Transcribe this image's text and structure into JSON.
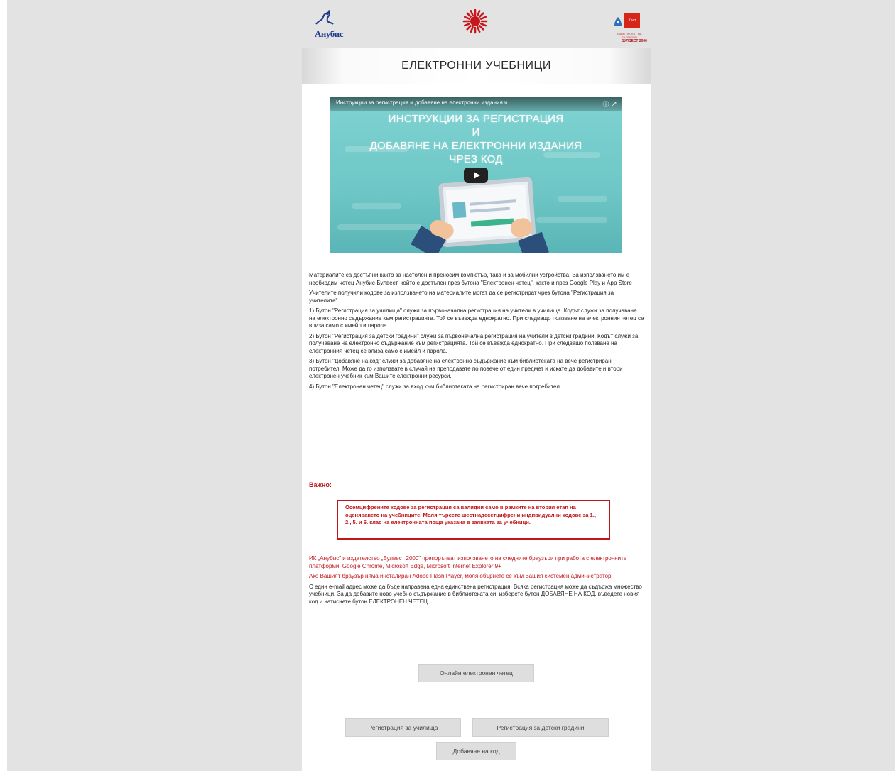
{
  "logos": {
    "left_text": "Анубис",
    "middle_text": "БУЛВЕСТ 2000",
    "right_text": "Клет",
    "right_subtext": "ЕДИН ПРОЕКТ НА БЪЛГАРИЯ"
  },
  "page_title": "ЕЛЕКТРОННИ УЧЕБНИЦИ",
  "video": {
    "title": "Инструкции за регистрация и добавяне на електронни издания ч...",
    "headline_1": "ИНСТРУКЦИИ ЗА РЕГИСТРАЦИЯ",
    "headline_2": "И",
    "headline_3": "ДОБАВЯНЕ НА ЕЛЕКТРОННИ ИЗДАНИЯ",
    "headline_4": "ЧРЕЗ КОД"
  },
  "paragraphs": {
    "p1": "Материалите са достъпни както за настолен и преносим компютър, така и за мобилни устройства. За използването им е необходим четец Анубис-Булвест, който е достъпен през бутона \"Електронен четец\", както и през Google Play и App Store",
    "p2": "Учителите получили кодове за използването на материалите могат да се регистрират чрез бутона \"Регистрация за учителите\".",
    "p3": "1) Бутон \"Регистрация за училища\" служи за първоначална регистрация на учители в училища. Кодът служи за получаване на електронно съдържание към регистрацията. Той се въвежда еднократно. При следващо ползване на електронния четец се влиза само с имейл и парола.",
    "p4": "2) Бутон \"Регистрация за детски градини\" служи за първоначална регистрация на учители в детски градини. Кодът служи за получаване на електронно съдържание към регистрацията. Той се въвежда еднократно. При следващо ползване на електронния четец се влиза само с имейл и парола.",
    "p5": "3) Бутон \"Добавяне на код\" служи за добавяне на електронно съдържание към библиотеката на вече регистриран потребител. Може да го използвате в случай на преподавате по повече от един предмет и искате да добавите и втори електронен учебник към Вашите електронни ресурси.",
    "p6": "4) Бутон \"Електронен четец\" служи за вход към библиотеката на регистриран вече потребител."
  },
  "warning": {
    "label": "Важно:",
    "box_text": "Осемцифрените кодове за регистрация са валидни само в рамките на втория етап на оценяването на учебниците. Моля търсете шестнадесетцифрени индивидуални кодове за 1., 2., 5. и 6. клас на електронната поща указана в заявката за учебници."
  },
  "notes": {
    "browsers": "ИК „Анубис\" и издателство „Булвест 2000\" препоръчват използването на следните браузъри при работа с електронните платформи: Google Chrome, Microsoft Edge, Microsoft Internet Explorer 9+",
    "flash": "Ако Вашият браузър няма инсталиран Adobe Flash Player, моля обърнете се към Вашия системен администратор.",
    "email": "С един e-mail адрес може да бъде направена една единствена регистрация. Всяка регистрация може да съдържа множество учебници. За да добавите ново учебно съдържание в библиотеката си, изберете бутон ДОБАВЯНЕ НА КОД, въведете новия код и натиснете бутон ЕЛЕКТРОНЕН ЧЕТЕЦ."
  },
  "buttons": {
    "online_reader": "Онлайн електронен четец",
    "register_schools": "Регистрация за училища",
    "register_kindergartens": "Регистрация за детски градини",
    "add_code": "Добавяне на код"
  },
  "colors": {
    "accent_red": "#c0161b",
    "video_teal": "#6ec7c6",
    "page_bg": "#e3e3e3"
  }
}
